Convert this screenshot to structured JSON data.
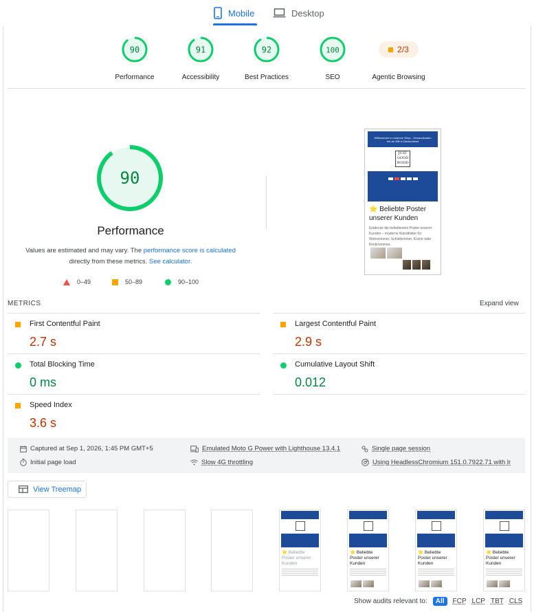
{
  "tabs": [
    {
      "label": "Mobile",
      "active": true,
      "icon": "phone-icon"
    },
    {
      "label": "Desktop",
      "active": false,
      "icon": "laptop-icon"
    }
  ],
  "colors": {
    "pass": "#0cce6b",
    "average": "#ffa400",
    "fail": "#ff4e42",
    "accent": "#1a73e8"
  },
  "categories": [
    {
      "score": "90",
      "label": "Performance"
    },
    {
      "score": "91",
      "label": "Accessibility"
    },
    {
      "score": "92",
      "label": "Best Practices"
    },
    {
      "score": "100",
      "label": "SEO"
    }
  ],
  "agentic": {
    "score": "2/3",
    "label": "Agentic Browsing"
  },
  "performance": {
    "score": "90",
    "title": "Performance",
    "note_before": "Values are estimated and may vary. The ",
    "note_link1": "performance score is calculated",
    "note_mid": "directly from these metrics. ",
    "note_link2": "See calculator.",
    "legend": {
      "fail": "0–49",
      "average": "50–89",
      "pass": "90–100"
    }
  },
  "screenshot": {
    "banner": "Willkommen in unserem Shop - Versandkosten frei ab 49€ in Deutschland",
    "logo": [
      "JUST",
      "GOOD",
      "WOOD"
    ],
    "heading": "⭐ Beliebte Poster unserer Kunden",
    "body": "Entdecke die beliebtesten Poster unserer Kunden – moderne Wandbilder für Wohnzimmer, Schlafzimmer, Küche oder Kinderzimmer."
  },
  "metrics": {
    "title": "METRICS",
    "expand_label": "Expand view",
    "items": [
      {
        "name": "First Contentful Paint",
        "value": "2.7 s",
        "rating": "average"
      },
      {
        "name": "Largest Contentful Paint",
        "value": "2.9 s",
        "rating": "average"
      },
      {
        "name": "Total Blocking Time",
        "value": "0 ms",
        "rating": "pass"
      },
      {
        "name": "Cumulative Layout Shift",
        "value": "0.012",
        "rating": "pass"
      },
      {
        "name": "Speed Index",
        "value": "3.6 s",
        "rating": "average"
      }
    ]
  },
  "runtime": {
    "captured": "Captured at Sep 1, 2026, 1:45 PM GMT+5",
    "load": "Initial page load",
    "device": "Emulated Moto G Power with Lighthouse 13.4.1",
    "throttling": "Slow 4G throttling",
    "session": "Single page session",
    "browser": "Using HeadlessChromium 151.0.7922.71 with lr"
  },
  "treemap_label": "View Treemap",
  "filmstrip_heading": "⭐ Beliebte Poster unserer Kunden",
  "audits": {
    "label": "Show audits relevant to:",
    "filters": [
      "All",
      "FCP",
      "LCP",
      "TBT",
      "CLS"
    ]
  }
}
